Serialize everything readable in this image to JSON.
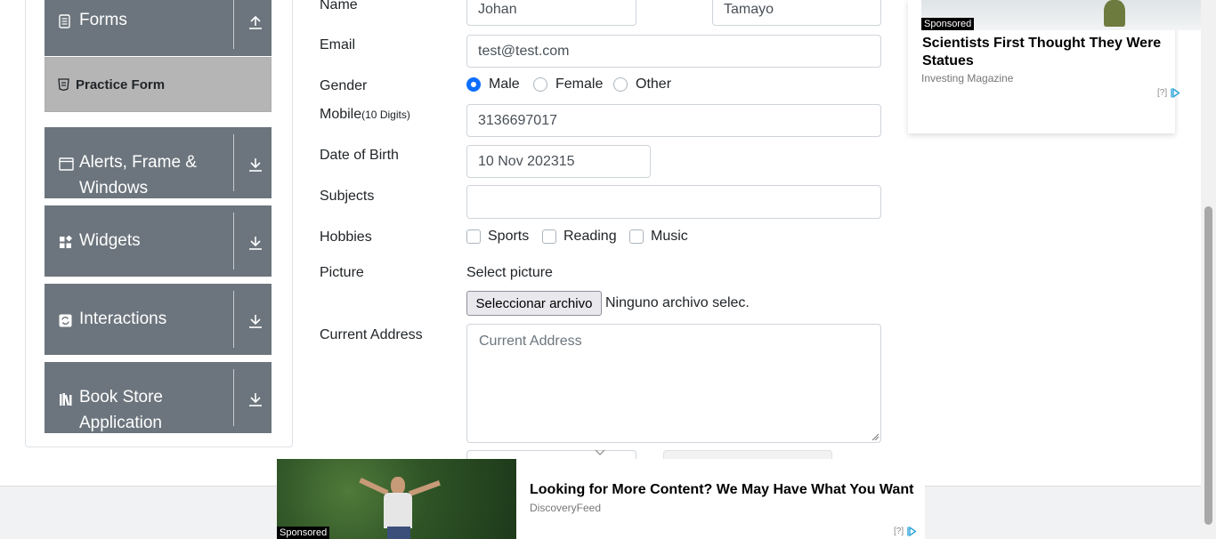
{
  "sidebar": {
    "forms_label": "Forms",
    "practice_form_label": "Practice Form",
    "groups": [
      {
        "label_line1": "Alerts, Frame &",
        "label_line2": "Windows"
      },
      {
        "label_line1": "Widgets",
        "label_line2": ""
      },
      {
        "label_line1": "Interactions",
        "label_line2": ""
      },
      {
        "label_line1": "Book Store",
        "label_line2": "Application"
      }
    ]
  },
  "form": {
    "name_label": "Name",
    "first_name": "Johan",
    "last_name": "Tamayo",
    "email_label": "Email",
    "email_value": "test@test.com",
    "gender_label": "Gender",
    "gender_options": [
      "Male",
      "Female",
      "Other"
    ],
    "gender_selected": "Male",
    "mobile_label": "Mobile",
    "mobile_hint": "(10 Digits)",
    "mobile_value": "3136697017",
    "dob_label": "Date of Birth",
    "dob_value": "10 Nov 202315",
    "subjects_label": "Subjects",
    "subjects_value": "",
    "hobbies_label": "Hobbies",
    "hobbies": [
      "Sports",
      "Reading",
      "Music"
    ],
    "picture_label": "Picture",
    "select_picture_label": "Select picture",
    "file_button_label": "Seleccionar archivo",
    "file_status": "Ninguno archivo selec.",
    "address_label": "Current Address",
    "address_placeholder": "Current Address"
  },
  "ad_right": {
    "sponsored": "Sponsored",
    "title": "Scientists First Thought They Were Statues",
    "source": "Investing Magazine",
    "adchoice": "[?]"
  },
  "ad_bottom": {
    "sponsored": "Sponsored",
    "title": "Looking for More Content? We May Have What You Want",
    "source": "DiscoveryFeed",
    "adchoice": "[?]"
  },
  "colors": {
    "sidebar_group": "#6c757d",
    "practice_active": "#b5b5b5",
    "accent": "#0d6efd",
    "adchoice_blue": "#2aa3d8"
  }
}
